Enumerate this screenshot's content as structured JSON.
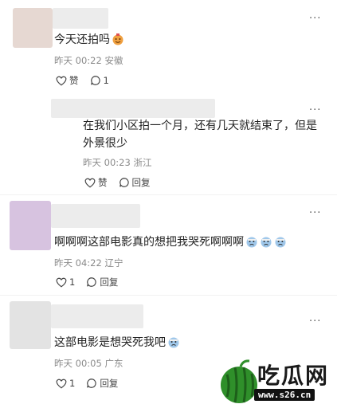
{
  "comments": [
    {
      "text": "今天还拍吗",
      "emoji": "cake",
      "time": "昨天 00:22",
      "location": "安徽",
      "like_label": "赞",
      "reply_count": "1"
    },
    {
      "text_line1": "在我们小区拍一个月，还有几天就结束了，但是",
      "text_line2": "外景很少",
      "time": "昨天 00:23",
      "location": "浙江",
      "like_label": "赞",
      "reply_label": "回复"
    },
    {
      "text": "啊啊啊这部电影真的想把我哭死啊啊啊",
      "emoji": "crying",
      "time": "昨天 04:22",
      "location": "辽宁",
      "like_count": "1",
      "reply_label": "回复"
    },
    {
      "text": "这部电影是想哭死我吧",
      "emoji": "crying",
      "time": "昨天 00:05",
      "location": "广东",
      "like_count": "1",
      "reply_label": "回复"
    }
  ],
  "more_label": "···",
  "watermark": {
    "title": "吃瓜网",
    "url": "www.s26.cn"
  },
  "colors": {
    "avatar1": "#e6d8d2",
    "avatar3": "#d7c3e0",
    "avatar4": "#e3e3e3",
    "text": "#222222",
    "meta": "#8a8a8a"
  }
}
